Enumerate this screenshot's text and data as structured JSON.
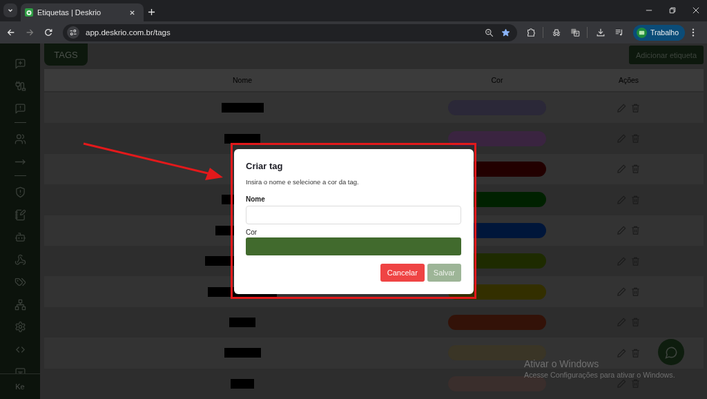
{
  "browser": {
    "tabs": [
      {
        "title": "Etiquetas | Deskrio",
        "selected": true
      }
    ],
    "url": "app.deskrio.com.br/tags",
    "bookmarked": true,
    "profile": "Trabalho"
  },
  "sidebar": {
    "footer": "Ke"
  },
  "header": {
    "title": "TAGS",
    "add_button": "Adicionar etiqueta"
  },
  "table": {
    "columns": [
      "Nome",
      "Cor",
      "Ações"
    ],
    "rows": [
      {
        "color": "#2b2838"
      },
      {
        "color": "#3a2440"
      },
      {
        "color": "#220000"
      },
      {
        "color": "#002100"
      },
      {
        "color": "#00163a"
      },
      {
        "color": "#1e2b00"
      },
      {
        "color": "#332f00"
      },
      {
        "color": "#331208"
      },
      {
        "color": "#3a3526"
      },
      {
        "color": "#3a2e2c"
      }
    ]
  },
  "dialog": {
    "title": "Criar tag",
    "description": "Insira o nome e selecione a cor da tag.",
    "name_field": {
      "label": "Nome"
    },
    "color_field": {
      "label": "Cor",
      "color": "#416a2d"
    },
    "buttons": [
      {
        "kind": "cancel",
        "label": "Cancelar",
        "disabled": false
      },
      {
        "kind": "save",
        "label": "Salvar",
        "disabled": true
      }
    ]
  },
  "os_notice": {
    "title": "Ativar o Windows",
    "text": "Acesse Configurações para ativar o Windows."
  }
}
